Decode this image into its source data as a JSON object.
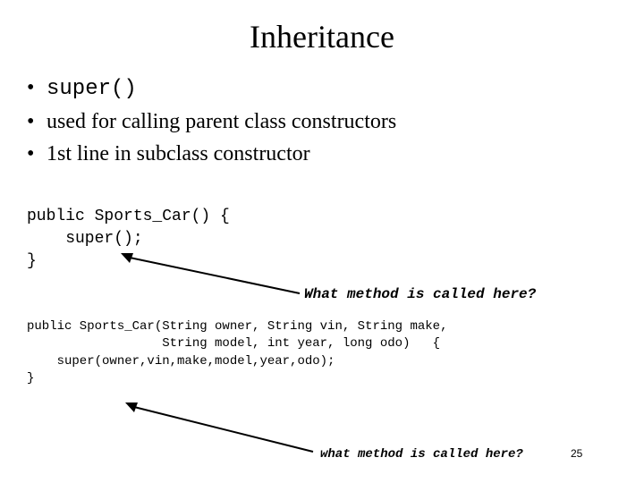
{
  "title": "Inheritance",
  "bullets": [
    {
      "text": "super()",
      "mono": true
    },
    {
      "text": "used for calling parent class constructors",
      "mono": false
    },
    {
      "text": "1st line in subclass constructor",
      "mono": false
    }
  ],
  "code1": {
    "line1": "public Sports_Car() {",
    "line2": "    super();",
    "line3": "}"
  },
  "annotation1": "What method is called here?",
  "code2": {
    "line1": "public Sports_Car(String owner, String vin, String make,",
    "line2": "                  String model, int year, long odo)   {",
    "line3": "    super(owner,vin,make,model,year,odo);",
    "line4": "}"
  },
  "annotation2": "what method is called here?",
  "page_number": "25"
}
